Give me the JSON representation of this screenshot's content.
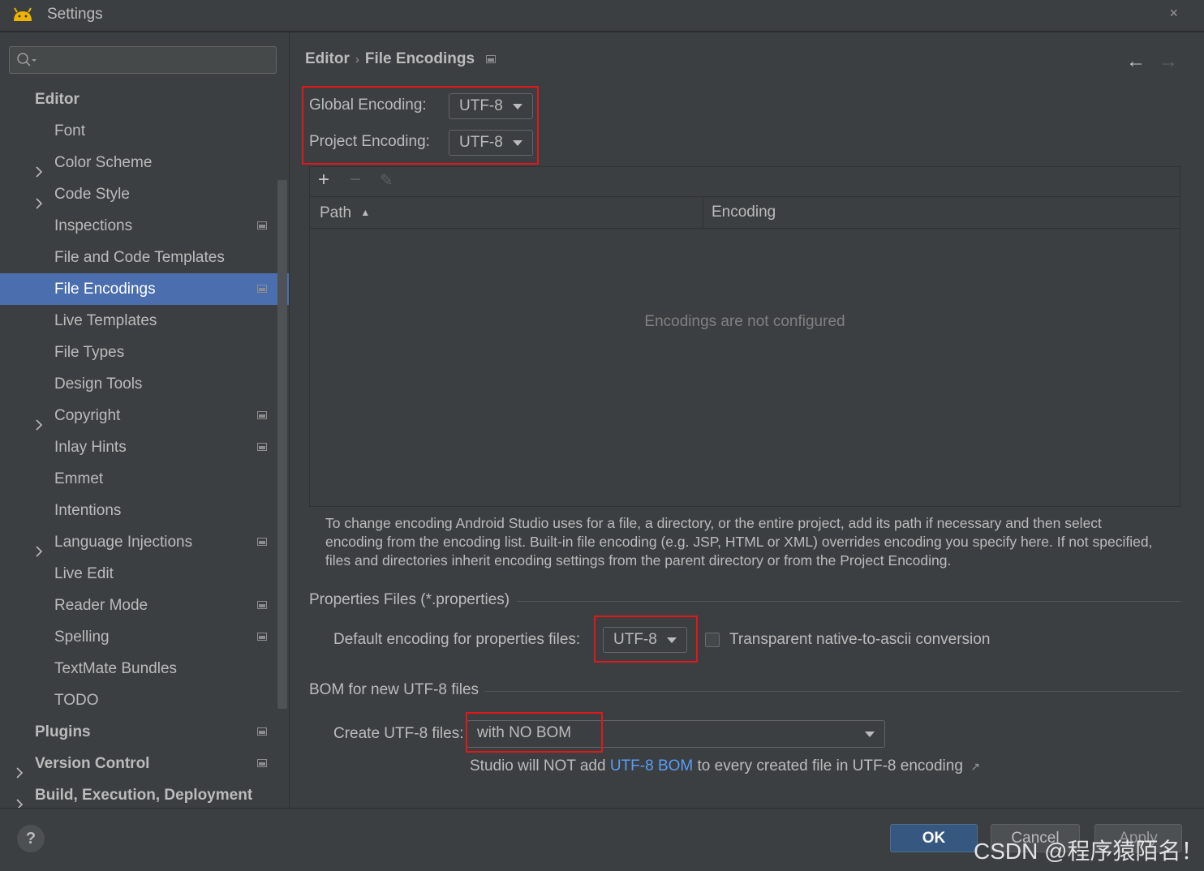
{
  "window": {
    "title": "Settings",
    "close_glyph": "×"
  },
  "sidebar": {
    "search_placeholder": "",
    "items": [
      {
        "label": "Editor",
        "level": "top",
        "chevron": false,
        "proj": false
      },
      {
        "label": "Font",
        "level": "sub",
        "chevron": false,
        "proj": false
      },
      {
        "label": "Color Scheme",
        "level": "sub",
        "chevron": true,
        "proj": false
      },
      {
        "label": "Code Style",
        "level": "sub",
        "chevron": true,
        "proj": false
      },
      {
        "label": "Inspections",
        "level": "sub",
        "chevron": false,
        "proj": true
      },
      {
        "label": "File and Code Templates",
        "level": "sub",
        "chevron": false,
        "proj": false
      },
      {
        "label": "File Encodings",
        "level": "sub",
        "chevron": false,
        "proj": true,
        "selected": true
      },
      {
        "label": "Live Templates",
        "level": "sub",
        "chevron": false,
        "proj": false
      },
      {
        "label": "File Types",
        "level": "sub",
        "chevron": false,
        "proj": false
      },
      {
        "label": "Design Tools",
        "level": "sub",
        "chevron": false,
        "proj": false
      },
      {
        "label": "Copyright",
        "level": "sub",
        "chevron": true,
        "proj": true
      },
      {
        "label": "Inlay Hints",
        "level": "sub",
        "chevron": false,
        "proj": true
      },
      {
        "label": "Emmet",
        "level": "sub",
        "chevron": false,
        "proj": false
      },
      {
        "label": "Intentions",
        "level": "sub",
        "chevron": false,
        "proj": false
      },
      {
        "label": "Language Injections",
        "level": "sub",
        "chevron": true,
        "proj": true
      },
      {
        "label": "Live Edit",
        "level": "sub",
        "chevron": false,
        "proj": false
      },
      {
        "label": "Reader Mode",
        "level": "sub",
        "chevron": false,
        "proj": true
      },
      {
        "label": "Spelling",
        "level": "sub",
        "chevron": false,
        "proj": true
      },
      {
        "label": "TextMate Bundles",
        "level": "sub",
        "chevron": false,
        "proj": false
      },
      {
        "label": "TODO",
        "level": "sub",
        "chevron": false,
        "proj": false
      },
      {
        "label": "Plugins",
        "level": "top",
        "chevron": false,
        "proj": true
      },
      {
        "label": "Version Control",
        "level": "top",
        "chevron": true,
        "proj": true
      },
      {
        "label": "Build, Execution, Deployment",
        "level": "top",
        "chevron": true,
        "proj": false
      }
    ]
  },
  "breadcrumb": {
    "parent": "Editor",
    "separator": "›",
    "current": "File Encodings"
  },
  "nav": {
    "back": "←",
    "forward": "→"
  },
  "encodings": {
    "global_label": "Global Encoding:",
    "global_value": "UTF-8",
    "project_label": "Project Encoding:",
    "project_value": "UTF-8"
  },
  "table": {
    "toolbar": {
      "add": "+",
      "remove": "−",
      "edit": "✎"
    },
    "columns": {
      "path": "Path",
      "sort_glyph": "▲",
      "encoding": "Encoding"
    },
    "empty_text": "Encodings are not configured"
  },
  "help_text": "To change encoding Android Studio uses for a file, a directory, or the entire project, add its path if necessary and then select encoding from the encoding list. Built-in file encoding (e.g. JSP, HTML or XML) overrides encoding you specify here. If not specified, files and directories inherit encoding settings from the parent directory or from the Project Encoding.",
  "properties": {
    "section_title": "Properties Files (*.properties)",
    "default_label": "Default encoding for properties files:",
    "default_value": "UTF-8",
    "transparent_label": "Transparent native-to-ascii conversion",
    "transparent_checked": false
  },
  "bom": {
    "section_title": "BOM for new UTF-8 files",
    "create_label": "Create UTF-8 files:",
    "create_value": "with NO BOM",
    "note_pre": "Studio will NOT add ",
    "note_link": "UTF-8 BOM",
    "note_post": " to every created file in UTF-8 encoding",
    "note_arrow": "↗"
  },
  "buttons": {
    "help": "?",
    "ok": "OK",
    "cancel": "Cancel",
    "apply": "Apply"
  },
  "watermark": "CSDN @程序猿陌名！",
  "colors": {
    "highlight_box": "#e0181a",
    "selection": "#4b6eaf",
    "link": "#589df6"
  }
}
